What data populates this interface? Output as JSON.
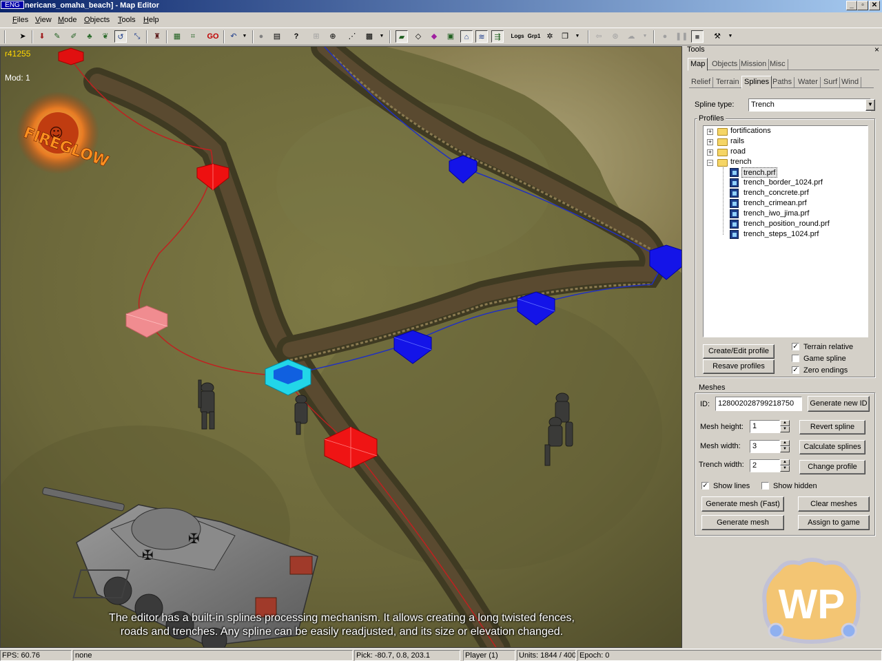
{
  "window": {
    "lang": "ENG",
    "title": "nericans_omaha_beach] - Map Editor",
    "min_btn": "_",
    "max_btn": "▫",
    "close_btn": "✕"
  },
  "menu": {
    "items": [
      "Files",
      "View",
      "Mode",
      "Objects",
      "Tools",
      "Help"
    ]
  },
  "toolbar": {
    "go_label": "GO",
    "logs_label": "Logs",
    "grp_label": "Grp1"
  },
  "viewport": {
    "r_label": "r41255",
    "mod_label": "Mod: 1",
    "logo_text": "FIREGLOW",
    "caption_line1": "The editor has a built-in splines processing mechanism. It allows creating a long twisted fences,",
    "caption_line2": "roads and trenches. Any spline can be easily readjusted, and its size or elevation changed.",
    "watermark": "WP"
  },
  "tools": {
    "title": "Tools",
    "close": "×",
    "main_tabs": [
      "Map",
      "Objects",
      "Mission",
      "Misc"
    ],
    "active_main_tab": "Map",
    "sub_tabs": [
      "Relief",
      "Terrain",
      "Splines",
      "Paths",
      "Water",
      "Surf",
      "Wind"
    ],
    "active_sub_tab": "Splines",
    "spline_type_label": "Spline type:",
    "spline_type_value": "Trench",
    "profiles_label": "Profiles",
    "tree": {
      "folders": [
        "fortifications",
        "rails",
        "road",
        "trench"
      ],
      "trench_files": [
        "trench.prf",
        "trench_border_1024.prf",
        "trench_concrete.prf",
        "trench_crimean.prf",
        "trench_iwo_jima.prf",
        "trench_position_round.prf",
        "trench_steps_1024.prf"
      ],
      "selected": "trench.prf"
    },
    "create_edit_profile": "Create/Edit profile",
    "resave_profiles": "Resave profiles",
    "terrain_relative": {
      "label": "Terrain relative",
      "checked": true
    },
    "game_spline": {
      "label": "Game spline",
      "checked": false
    },
    "zero_endings": {
      "label": "Zero endings",
      "checked": true
    },
    "meshes_label": "Meshes",
    "id_label": "ID:",
    "id_value": "128002028799218750",
    "generate_new_id": "Generate new ID",
    "mesh_height_label": "Mesh height:",
    "mesh_height_value": "1",
    "mesh_width_label": "Mesh width:",
    "mesh_width_value": "3",
    "trench_width_label": "Trench width:",
    "trench_width_value": "2",
    "revert_spline": "Revert spline",
    "calculate_splines": "Calculate splines",
    "change_profile": "Change profile",
    "show_lines": {
      "label": "Show lines",
      "checked": true
    },
    "show_hidden": {
      "label": "Show hidden",
      "checked": false
    },
    "generate_mesh_fast": "Generate mesh (Fast)",
    "clear_meshes": "Clear meshes",
    "generate_mesh": "Generate mesh",
    "assign_to_game": "Assign to game"
  },
  "status": {
    "fps": "FPS: 60.76",
    "selection": "none",
    "pick": "Pick: -80.7, 0.8, 203.1",
    "player": "Player (1)",
    "units": "Units: 1844 / 400",
    "epoch": "Epoch: 0"
  }
}
